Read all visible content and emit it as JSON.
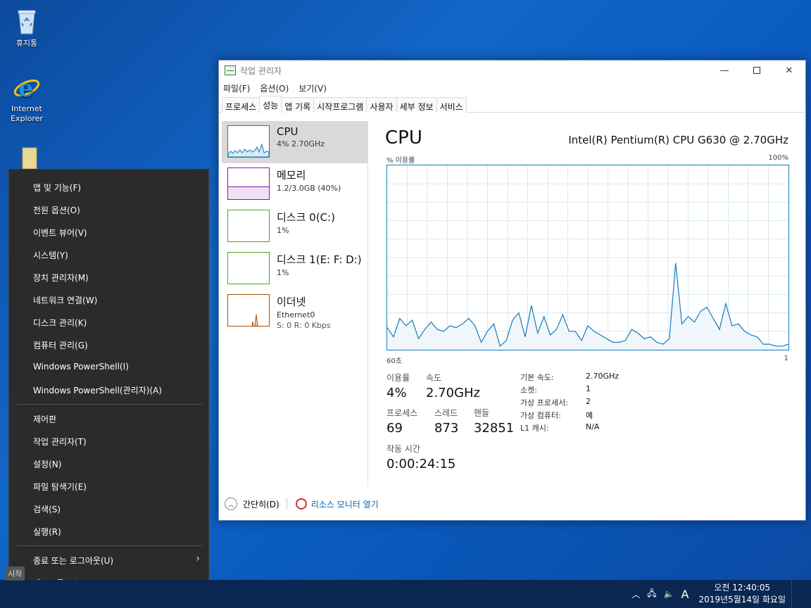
{
  "desktop": {
    "icons": [
      {
        "label": "휴지통"
      },
      {
        "label": "Internet Explorer"
      }
    ]
  },
  "taskmgr": {
    "title": "작업 관리자",
    "menu": [
      "파일(F)",
      "옵션(O)",
      "보기(V)"
    ],
    "tabs": [
      "프로세스",
      "성능",
      "앱 기록",
      "시작프로그램",
      "사용자",
      "세부 정보",
      "서비스"
    ],
    "sidebar": [
      {
        "name": "CPU",
        "sub": "4% 2.70GHz",
        "color": "#117dbb"
      },
      {
        "name": "메모리",
        "sub": "1.2/3.0GB (40%)",
        "color": "#8b12ae"
      },
      {
        "name": "디스크 0(C:)",
        "sub": "1%",
        "color": "#4da60c"
      },
      {
        "name": "디스크 1(E: F: D:)",
        "sub": "1%",
        "color": "#4da60c"
      },
      {
        "name": "이더넷",
        "sub": "Ethernet0",
        "sub2": "S: 0 R: 0 Kbps",
        "color": "#a74f01"
      }
    ],
    "main": {
      "title": "CPU",
      "model": "Intel(R) Pentium(R) CPU G630 @ 2.70GHz",
      "y_label": "% 이용률",
      "y_max": "100%",
      "x_left": "60초",
      "x_right": "1",
      "stats": {
        "util_label": "이용률",
        "util": "4%",
        "speed_label": "속도",
        "speed": "2.70GHz",
        "proc_label": "프로세스",
        "proc": "69",
        "threads_label": "스레드",
        "threads": "873",
        "handles_label": "핸들",
        "handles": "32851",
        "uptime_label": "작동 시간",
        "uptime": "0:00:24:15"
      },
      "specs": [
        {
          "k": "기본 속도:",
          "v": "2.70GHz"
        },
        {
          "k": "소켓:",
          "v": "1"
        },
        {
          "k": "가상 프로세서:",
          "v": "2"
        },
        {
          "k": "가상 컴퓨터:",
          "v": "예"
        },
        {
          "k": "L1 캐시:",
          "v": "N/A"
        }
      ]
    },
    "footer": {
      "fewer": "간단히(D)",
      "resmon": "리소스 모니터 열기"
    }
  },
  "chart_data": {
    "type": "line",
    "x": [
      60,
      59,
      58,
      57,
      56,
      55,
      54,
      53,
      52,
      51,
      50,
      49,
      48,
      47,
      46,
      45,
      44,
      43,
      42,
      41,
      40,
      39,
      38,
      37,
      36,
      35,
      34,
      33,
      32,
      31,
      30,
      29,
      28,
      27,
      26,
      25,
      24,
      23,
      22,
      21,
      20,
      19,
      18,
      17,
      16,
      15,
      14,
      13,
      12,
      11,
      10,
      9,
      8,
      7,
      6,
      5,
      4,
      3,
      2,
      1
    ],
    "values": [
      12,
      7,
      17,
      13,
      16,
      6,
      11,
      15,
      11,
      10,
      13,
      12,
      14,
      17,
      13,
      4,
      10,
      14,
      2,
      5,
      16,
      20,
      7,
      24,
      9,
      18,
      8,
      11,
      19,
      10,
      10,
      5,
      13,
      10,
      8,
      6,
      4,
      4,
      5,
      11,
      9,
      6,
      7,
      4,
      3,
      6,
      47,
      14,
      18,
      15,
      21,
      23,
      17,
      11,
      25,
      13,
      14,
      10,
      8,
      7,
      3,
      3,
      2,
      2,
      3
    ],
    "ylim": [
      0,
      100
    ],
    "grid": true
  },
  "winx": {
    "items": [
      "앱 및 기능(F)",
      "전원 옵션(O)",
      "이벤트 뷰어(V)",
      "시스템(Y)",
      "장치 관리자(M)",
      "네트워크 연결(W)",
      "디스크 관리(K)",
      "컴퓨터 관리(G)",
      "Windows PowerShell(I)",
      "Windows PowerShell(관리자)(A)",
      "제어판",
      "작업 관리자(T)",
      "설정(N)",
      "파일 탐색기(E)",
      "검색(S)",
      "실행(R)",
      "종료 또는 로그아웃(U)",
      "데스크톱(D)"
    ]
  },
  "taskbar": {
    "start_tooltip": "시작",
    "ime": "A",
    "time": "오전 12:40:05",
    "date": "2019년5월14일 화요일"
  }
}
